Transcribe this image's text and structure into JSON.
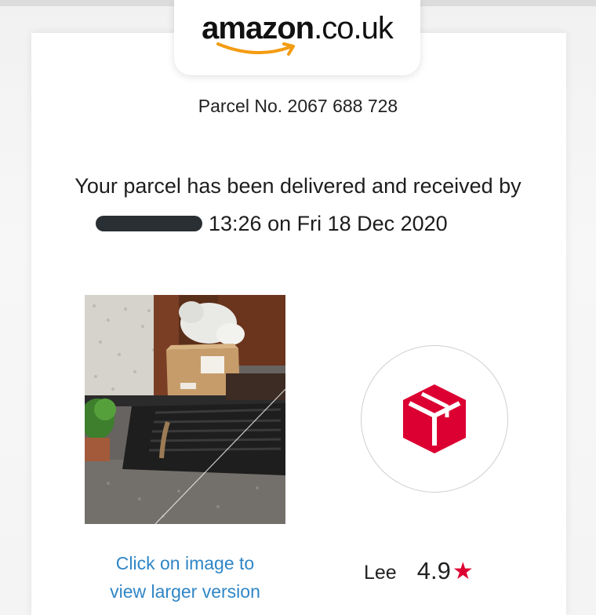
{
  "logo": {
    "brand": "amazon",
    "domain": ".co.uk",
    "smile_color": "#f39c12"
  },
  "parcel": {
    "number_text": "Parcel No. 2067 688 728"
  },
  "delivery": {
    "line1": "Your parcel has been delivered and received by",
    "line2_suffix": "13:26 on Fri 18 Dec 2020"
  },
  "photo": {
    "caption_line1": "Click on image to",
    "caption_line2": "view larger version"
  },
  "driver": {
    "name": "Lee",
    "rating": "4.9",
    "star_glyph": "★",
    "star_color": "#dc0032"
  },
  "badge": {
    "icon": "dpd-parcel-icon",
    "color": "#dc0032"
  }
}
